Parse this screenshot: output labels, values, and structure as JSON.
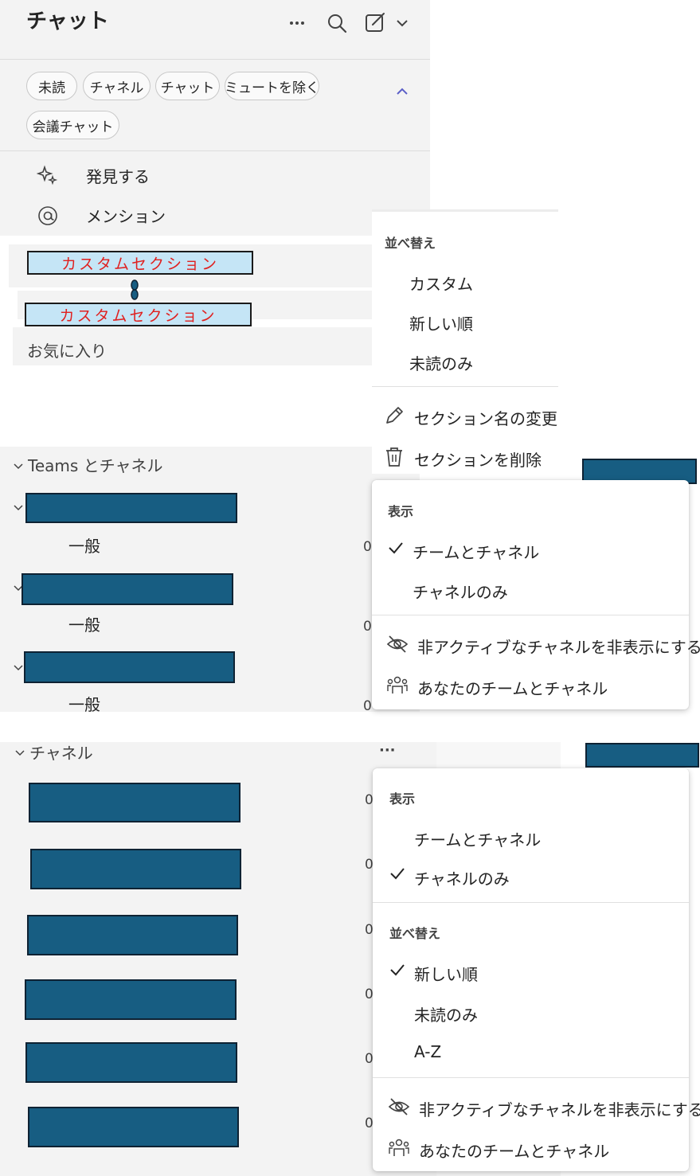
{
  "header": {
    "title": "チャット"
  },
  "filters": [
    "未読",
    "チャネル",
    "チャット",
    "ミュートを除く",
    "会議チャット"
  ],
  "nav": {
    "discover": "発見する",
    "mentions": "メンション"
  },
  "custom_sections": [
    "カスタムセクション",
    "カスタムセクション"
  ],
  "favorites": "お気に入り",
  "section_menu": {
    "sort_header": "並べ替え",
    "sort_items": [
      "カスタム",
      "新しい順",
      "未読のみ"
    ],
    "rename": "セクション名の変更",
    "delete": "セクションを削除"
  },
  "teams_section": {
    "title": "Teams とチャネル",
    "general_label": "一般",
    "zero": "0"
  },
  "teams_menu": {
    "view_header": "表示",
    "view_items": [
      "チームとチャネル",
      "チャネルのみ"
    ],
    "hide_inactive": "非アクティブなチャネルを非表示にする",
    "your_teams": "あなたのチームとチャネル"
  },
  "channels_section": {
    "title": "チャネル",
    "more": "···",
    "zero": "0"
  },
  "channels_menu": {
    "view_header": "表示",
    "view_items": [
      "チームとチャネル",
      "チャネルのみ"
    ],
    "sort_header": "並べ替え",
    "sort_items": [
      "新しい順",
      "未読のみ",
      "A-Z"
    ],
    "hide_inactive": "非アクティブなチャネルを非表示にする",
    "your_teams": "あなたのチームとチャネル"
  },
  "colors": {
    "pane": "#f3f3f3",
    "redaction": "#175d82",
    "custom_fill": "#c5e5f6",
    "custom_text": "#e0201f",
    "accent": "#5b5fc7"
  }
}
